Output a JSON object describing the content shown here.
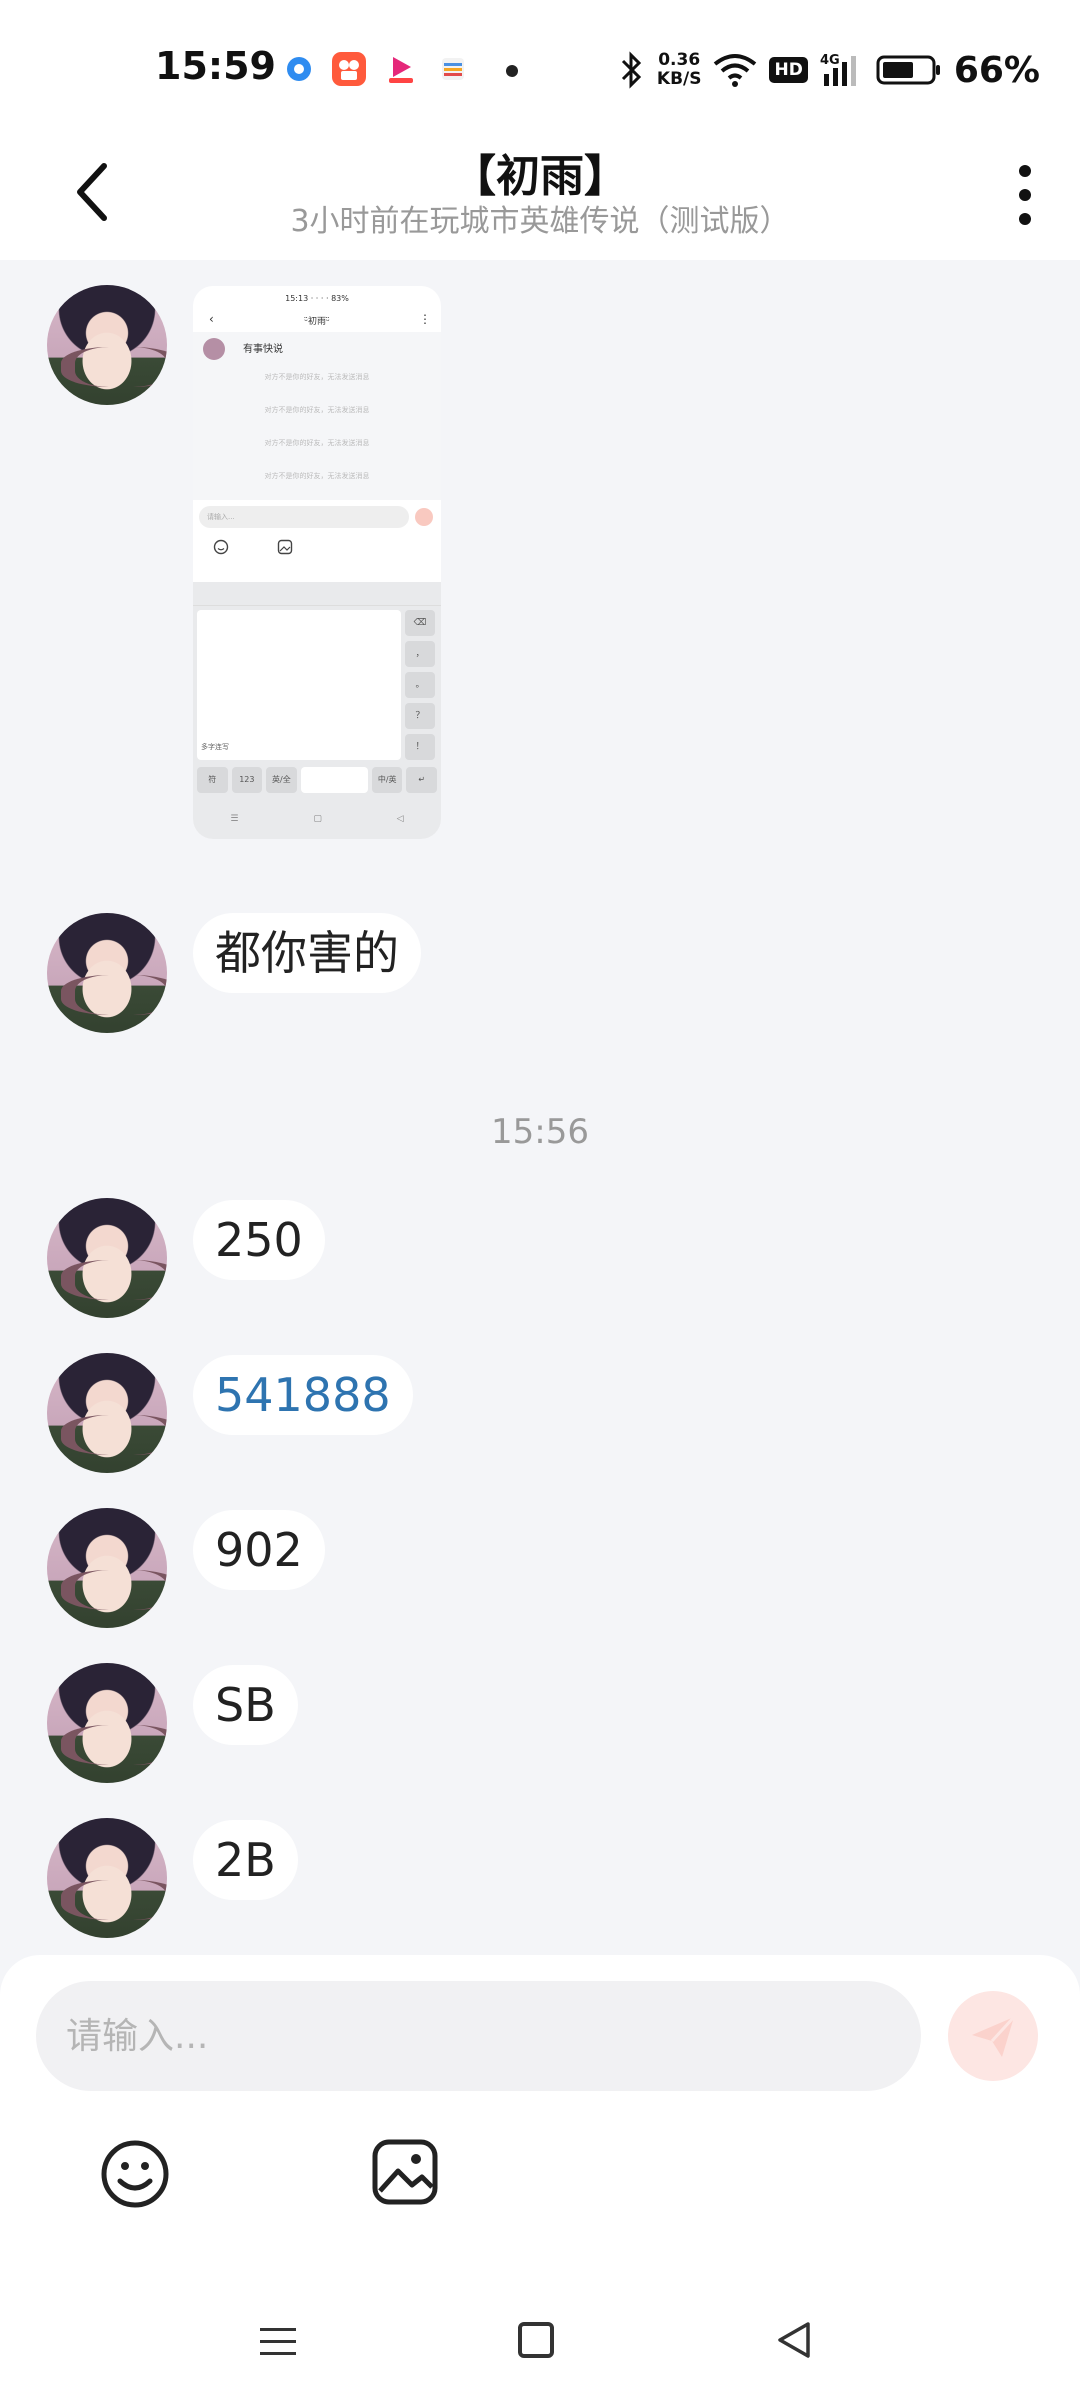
{
  "status_bar": {
    "time": "15:59",
    "speed_value": "0.36",
    "speed_unit": "KB/S",
    "hd_label": "HD",
    "network": "4G",
    "battery": "66%"
  },
  "header": {
    "title": "【初雨】",
    "subtitle": "3小时前在玩城市英雄传说（测试版）"
  },
  "embedded_screenshot": {
    "status": "15:13 · · · · 83%",
    "title": "ᵕ̈初雨ᵕ̈",
    "first_message": "有事快说",
    "system_notice": "对方不是你的好友，无法发送消息",
    "input_placeholder": "请输入...",
    "keyboard_label": "多字连写",
    "keys_right": [
      "⌫",
      "，",
      "。",
      "？",
      "！"
    ],
    "keys_bottom": [
      "符",
      "123",
      "英/全",
      "",
      "中/英",
      "↵"
    ]
  },
  "messages": [
    {
      "type": "image"
    },
    {
      "type": "text",
      "text": "都你害的"
    },
    {
      "type": "text",
      "text": "250"
    },
    {
      "type": "text",
      "text": "541888",
      "link": true
    },
    {
      "type": "text",
      "text": "902"
    },
    {
      "type": "text",
      "text": "SB"
    },
    {
      "type": "text",
      "text": "2B"
    }
  ],
  "timestamp": "15:56",
  "input": {
    "placeholder": "请输入..."
  },
  "icons": {
    "back": "back-arrow-icon",
    "more": "more-vertical-icon",
    "send": "send-icon",
    "emoji": "emoji-icon",
    "image": "image-icon"
  },
  "colors": {
    "accent": "#f6a89c",
    "background": "#f4f5f8",
    "link": "#2e74b0"
  }
}
